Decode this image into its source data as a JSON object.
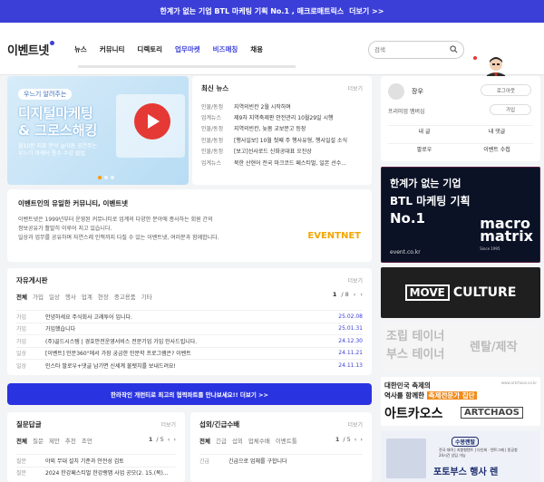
{
  "top_banner": {
    "text": "한계가 없는 기업 BTL 마케팅 기획 No.1 , 매크로매트릭스",
    "more": "더보기 >>"
  },
  "header": {
    "logo": "이벤트넷",
    "nav": [
      "뉴스",
      "커뮤니티",
      "디렉토리",
      "업무마켓",
      "비즈매칭",
      "채용"
    ],
    "search_placeholder": "검색"
  },
  "hero": {
    "kicker": "우느기 알려주는",
    "line1": "디지털마케팅",
    "line2": "& 그로스해킹",
    "sub1": "월10분 지표 분석 늘어몸 공연주는",
    "sub2": "우느기 마케터 통수 수강 클럽"
  },
  "news": {
    "title": "최신 뉴스",
    "more": "더보기",
    "items": [
      {
        "cat": "인물/동정",
        "title": "지역의빈칸 2월 시작하며"
      },
      {
        "cat": "업계뉴스",
        "title": "제9차 지역축제판 안전관리 10월29일 시행"
      },
      {
        "cat": "인물/동정",
        "title": "지역의빈칸, 늦봄 교보문고 등장"
      },
      {
        "cat": "인물/동정",
        "title": "[행사일보] 10월 첫째 주 행사유형, 행사일설 소식"
      },
      {
        "cat": "인물/동정",
        "title": "[보고]선사로드 신화공대표 오진상"
      },
      {
        "cat": "업계뉴스",
        "title": "북한 산현어 전국 마크코드 페스티벌, 일본 선수..."
      }
    ]
  },
  "community": {
    "title": "이벤트인의 유일한 커뮤니티, 이벤트넷",
    "desc1": "이벤트넷은 1999년부터 운영된 커뮤니티로 업계의 다양한 분야에 종사하는 회원 간의",
    "desc2": "정보공유가 활발히 이루어 지고 있습니다.",
    "desc3": "일상과 업무를 공유하며 자연스레 인맥까지 다질 수 있는 이벤트넷, 여러분과 함께합니다.",
    "logo": "EVENTNET"
  },
  "freeboard": {
    "title": "자유게시판",
    "more": "더보기",
    "tabs": [
      "전체",
      "가입",
      "일상",
      "행사",
      "업계",
      "현장",
      "중고용품",
      "기타"
    ],
    "page": "1",
    "pages": "/ 8",
    "posts": [
      {
        "cat": "가입",
        "title": "안녕하세요 주식회사 고래투어 입니다.",
        "date": "25.02.08"
      },
      {
        "cat": "가입",
        "title": "가입했습니다",
        "date": "25.01.31"
      },
      {
        "cat": "가입",
        "title": "(주)골드시스템 | 경호안전운영서비스 전문기업 가입 인사드립니다.",
        "date": "24.12.30"
      },
      {
        "cat": "일상",
        "title": "[이벤트] 인문360°에서 가장 궁금한 인문학 프로그램은? 이벤트",
        "date": "24.11.21"
      },
      {
        "cat": "일상",
        "title": "인스타 팔로우+댓글 남기면 신세계 불렛치를 보내드려요!",
        "date": "24.11.13"
      }
    ]
  },
  "blue_banner": {
    "text": "한라작인 개런티로 최고의 협력파트를 만나보세요!!",
    "more": "더보기 >>"
  },
  "qna": {
    "title": "질문답글",
    "more": "더보기",
    "tabs": [
      "전체",
      "질문",
      "제안",
      "추천",
      "조언"
    ],
    "page": "1",
    "pages": "/ 5",
    "posts": [
      {
        "cat": "질문",
        "title": "야외 무대 설치 기준과 안전성 검토"
      },
      {
        "cat": "질문",
        "title": "2024 한강페스티벌 한강랭맵 사업 공모(2. 15.(목)..."
      }
    ]
  },
  "urgent": {
    "title": "섭외/긴급수배",
    "more": "더보기",
    "tabs": [
      "전체",
      "긴급",
      "섭외",
      "업체수배",
      "이벤트툴"
    ],
    "page": "1",
    "pages": "/ 5",
    "posts": [
      {
        "cat": "긴급",
        "title": "긴급으로 업체를 구합니다"
      }
    ]
  },
  "profile": {
    "name": "장우",
    "logout": "로그아웃",
    "grade": "프리미엄 멤버십",
    "grade_btn": "가입",
    "grid": [
      "내 글",
      "내 댓글",
      "팔로우",
      "이벤트 수첩"
    ]
  },
  "ads": {
    "btl": {
      "l1": "한계가 없는 기업",
      "l2": "BTL 마케팅 기획",
      "l3": "No.1",
      "brand1": "macro",
      "brand2": "matrix",
      "since": "Since 1995",
      "site": "event.co.kr"
    },
    "move": {
      "mv": "MOVE",
      "text": "CULTURE"
    },
    "theater": {
      "l1": "조립 테이너",
      "l2": "부스 테이너",
      "l3": "렌탈/제작"
    },
    "artchaos": {
      "s1": "대한민국 축제의",
      "s2a": "역사를 함께한",
      "s2b": "축제전문가 집단",
      "big": "아트카오스",
      "big2": "ARTCHAOS",
      "url": "www.artchaos.co.kr"
    },
    "booth": {
      "logo": "수몽랜탈",
      "line1": "전국 대여 | 지붕형텐트 | 다인회 · 텐트그제 | 몽공청",
      "line2": "24시간 상담 가능",
      "title": "포토부스 행사 렌"
    }
  },
  "colors": {
    "brand": "#3b3fd8",
    "accent_orange": "#f28b1a",
    "date": "#3b3fd8"
  }
}
